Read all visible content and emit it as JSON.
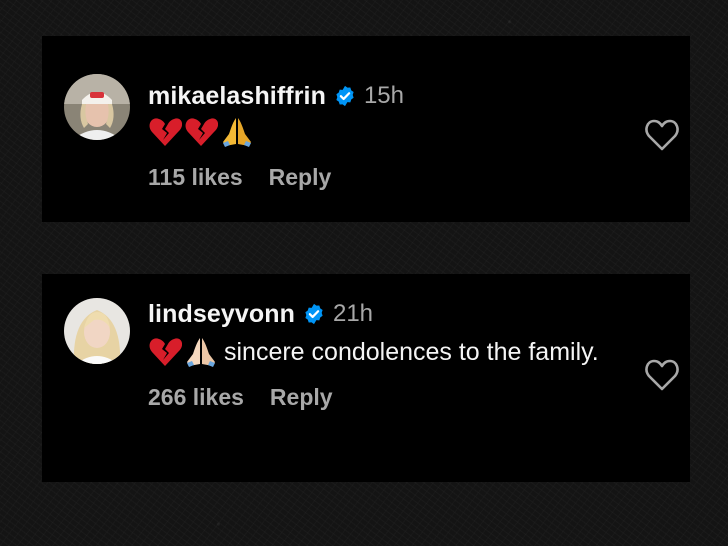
{
  "comments": [
    {
      "username": "mikaelashiffrin",
      "time": "15h",
      "emojis": [
        "broken-heart",
        "broken-heart",
        "folded-hands"
      ],
      "text": "",
      "likes": "115 likes",
      "reply_label": "Reply"
    },
    {
      "username": "lindseyvonn",
      "time": "21h",
      "emojis": [
        "broken-heart",
        "folded-hands"
      ],
      "text": "sincere condolences to the family.",
      "likes": "266 likes",
      "reply_label": "Reply"
    }
  ],
  "colors": {
    "card_background": "#000000",
    "primary_text": "#f5f5f5",
    "secondary_text": "#a8a8a8",
    "verified_blue": "#0095f6",
    "emoji_red": "#d81e2a",
    "emoji_hands": "#f3b935"
  }
}
